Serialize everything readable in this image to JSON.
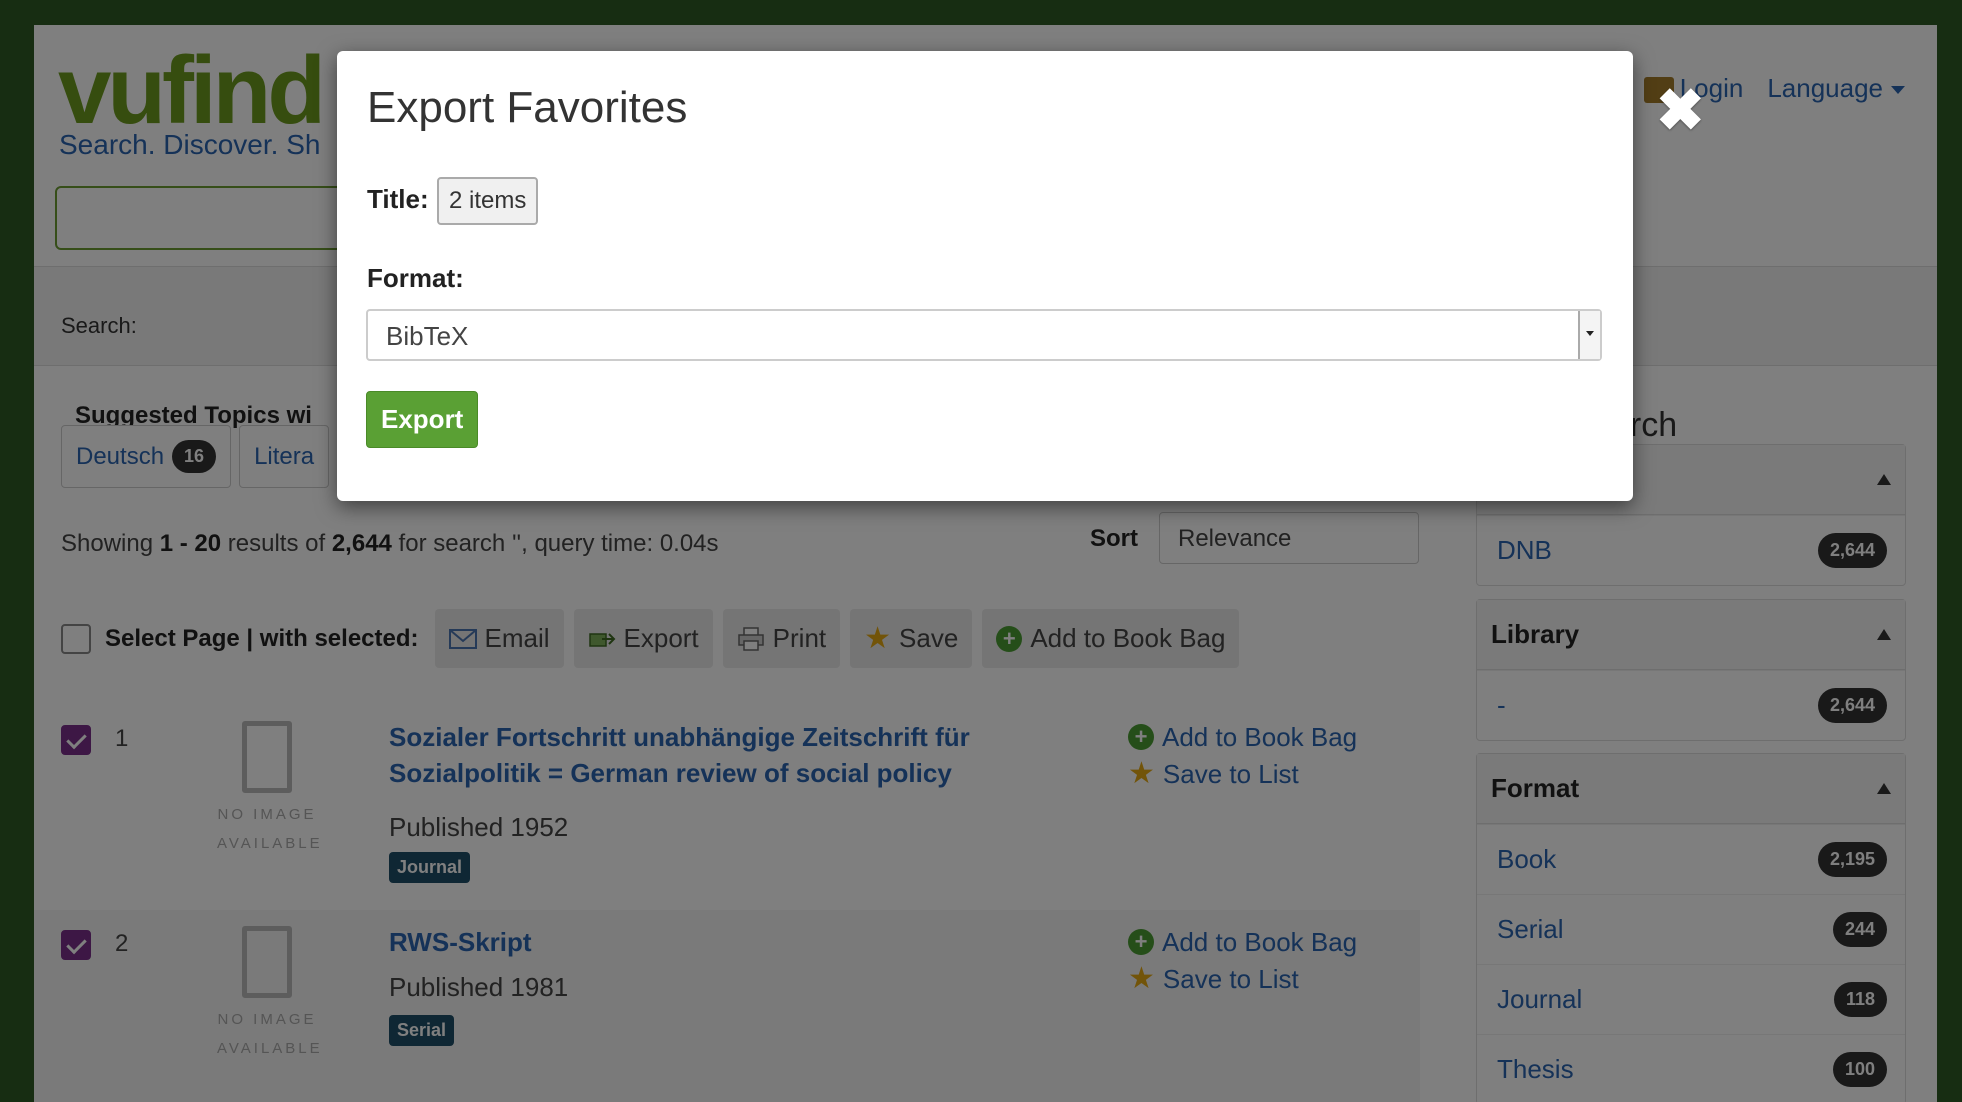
{
  "header": {
    "logo_main": "vufind",
    "tagline": "Search. Discover. Sh",
    "login": "Login",
    "language": "Language"
  },
  "search": {
    "label": "Search:"
  },
  "topics": {
    "heading": "Suggested Topics wi",
    "items": [
      {
        "label": "Deutsch",
        "count": "16"
      },
      {
        "label": "Litera"
      }
    ]
  },
  "results_summary": {
    "prefix": "Showing ",
    "range": "1 - 20",
    "mid": " results of ",
    "total": "2,644",
    "suffix": " for search '', query time: 0.04s"
  },
  "sort": {
    "label": "Sort",
    "value": "Relevance"
  },
  "toolbar": {
    "select_label": "Select Page | with selected:",
    "email": "Email",
    "export": "Export",
    "print": "Print",
    "save": "Save",
    "add_bag": "Add to Book Bag"
  },
  "results": [
    {
      "number": "1",
      "title": "Sozialer Fortschritt unabhängige Zeitschrift für Sozialpolitik = German review of social policy",
      "published": "Published 1952",
      "format": "Journal",
      "add_bag": "Add to Book Bag",
      "save_list": "Save to List",
      "noimg_line1": "NO IMAGE",
      "noimg_line2": "AVAILABLE"
    },
    {
      "number": "2",
      "title": "RWS-Skript",
      "published": "Published 1981",
      "format": "Serial",
      "add_bag": "Add to Book Bag",
      "save_list": "Save to List",
      "noimg_line1": "NO IMAGE",
      "noimg_line2": "AVAILABLE"
    }
  ],
  "sidebar": {
    "heading": "arch",
    "facets": [
      {
        "title": "",
        "items": [
          {
            "label": "DNB",
            "count": "2,644"
          }
        ]
      },
      {
        "title": "Library",
        "items": [
          {
            "label": "-",
            "count": "2,644"
          }
        ]
      },
      {
        "title": "Format",
        "items": [
          {
            "label": "Book",
            "count": "2,195"
          },
          {
            "label": "Serial",
            "count": "244"
          },
          {
            "label": "Journal",
            "count": "118"
          },
          {
            "label": "Thesis",
            "count": "100"
          }
        ]
      }
    ]
  },
  "modal": {
    "title": "Export Favorites",
    "title_label": "Title:",
    "title_value": "2 items",
    "format_label": "Format:",
    "format_value": "BibTeX",
    "export_button": "Export",
    "close": "✖"
  },
  "colors": {
    "page_bg": "#2f5a25",
    "link": "#2a64b0",
    "export_green": "#5aa034",
    "checkbox_purple": "#7a2f8a",
    "badge_blue": "#1f4f68"
  }
}
